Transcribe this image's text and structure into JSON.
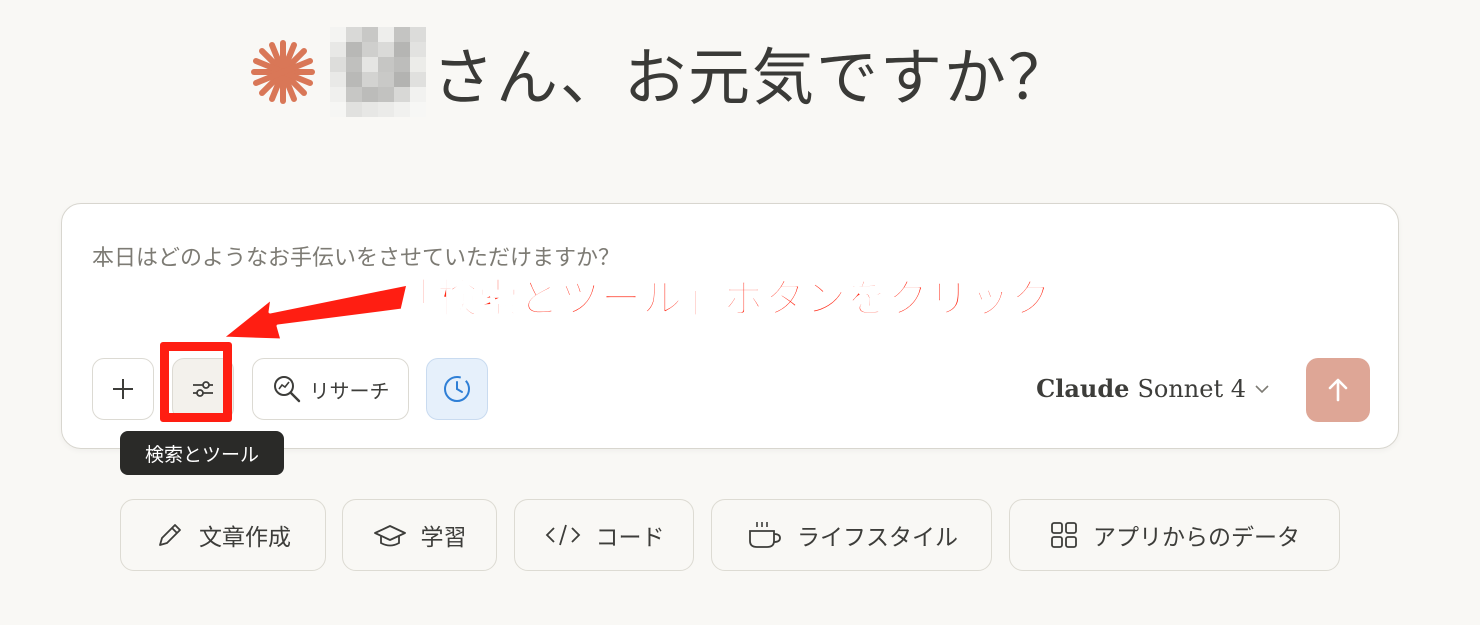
{
  "greeting": {
    "suffix": "さん、お元気ですか？"
  },
  "composer": {
    "placeholder": "本日はどのようなお手伝いをさせていただけますか？",
    "plus_label": "＋",
    "research_label": "リサーチ",
    "model": {
      "brand": "Claude",
      "name": "Sonnet 4"
    }
  },
  "tooltip": {
    "text": "検索とツール"
  },
  "annotation": {
    "text": "「検索とツール」ボタンをクリック"
  },
  "chips": [
    {
      "label": "文章作成",
      "icon": "pencil-icon"
    },
    {
      "label": "学習",
      "icon": "graduation-cap-icon"
    },
    {
      "label": "コード",
      "icon": "code-icon"
    },
    {
      "label": "ライフスタイル",
      "icon": "coffee-cup-icon"
    },
    {
      "label": "アプリからのデータ",
      "icon": "grid-icon"
    }
  ],
  "colors": {
    "accent": "#d97757",
    "send": "#dea696",
    "annotation": "#ff1e12",
    "background": "#f9f8f5"
  }
}
